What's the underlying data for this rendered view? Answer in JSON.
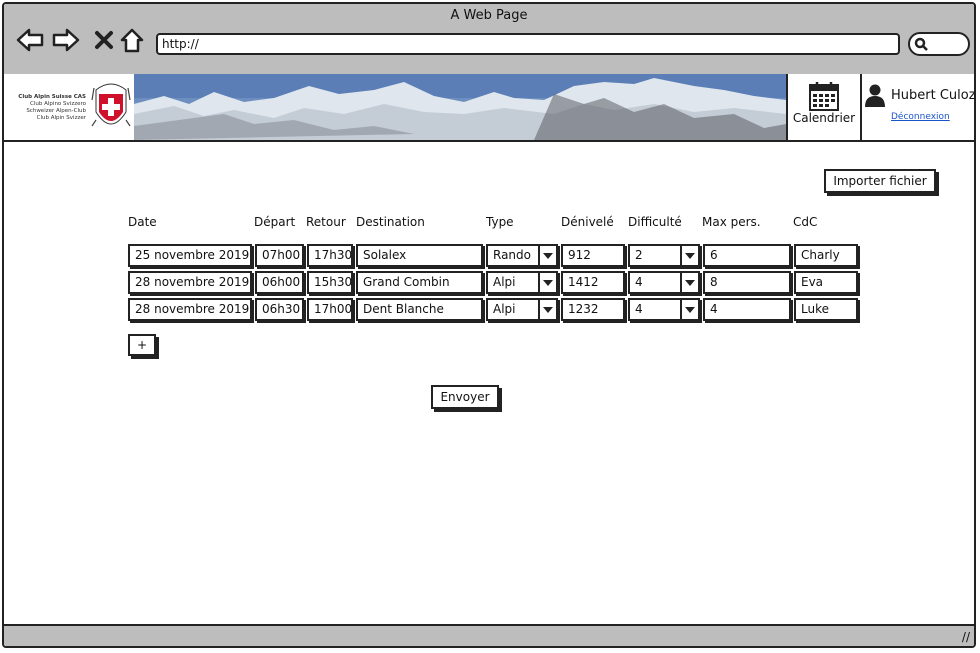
{
  "window": {
    "title": "A Web Page",
    "url": "http://"
  },
  "header": {
    "logo_lines": [
      "Club Alpin Suisse CAS",
      "Club Alpino Svizzero",
      "Schweizer Alpen-Club",
      "Club Alpin Svizzer"
    ],
    "calendar_label": "Calendrier",
    "user_name": "Hubert Culoze",
    "logout_label": "Déconnexion"
  },
  "actions": {
    "import_label": "Importer fichier",
    "add_label": "+",
    "submit_label": "Envoyer"
  },
  "table": {
    "headers": [
      "Date",
      "Départ",
      "Retour",
      "Destination",
      "Type",
      "Dénivelé",
      "Difficulté",
      "Max pers.",
      "CdC"
    ],
    "rows": [
      [
        "25 novembre 2019",
        "07h00",
        "17h30",
        "Solalex",
        "Rando",
        "912",
        "2",
        "6",
        "Charly"
      ],
      [
        "28 novembre 2019",
        "06h00",
        "15h30",
        "Grand Combin",
        "Alpi",
        "1412",
        "4",
        "8",
        "Eva"
      ],
      [
        "28 novembre 2019",
        "06h30",
        "17h00",
        "Dent Blanche",
        "Alpi",
        "1232",
        "4",
        "4",
        "Luke"
      ]
    ]
  }
}
